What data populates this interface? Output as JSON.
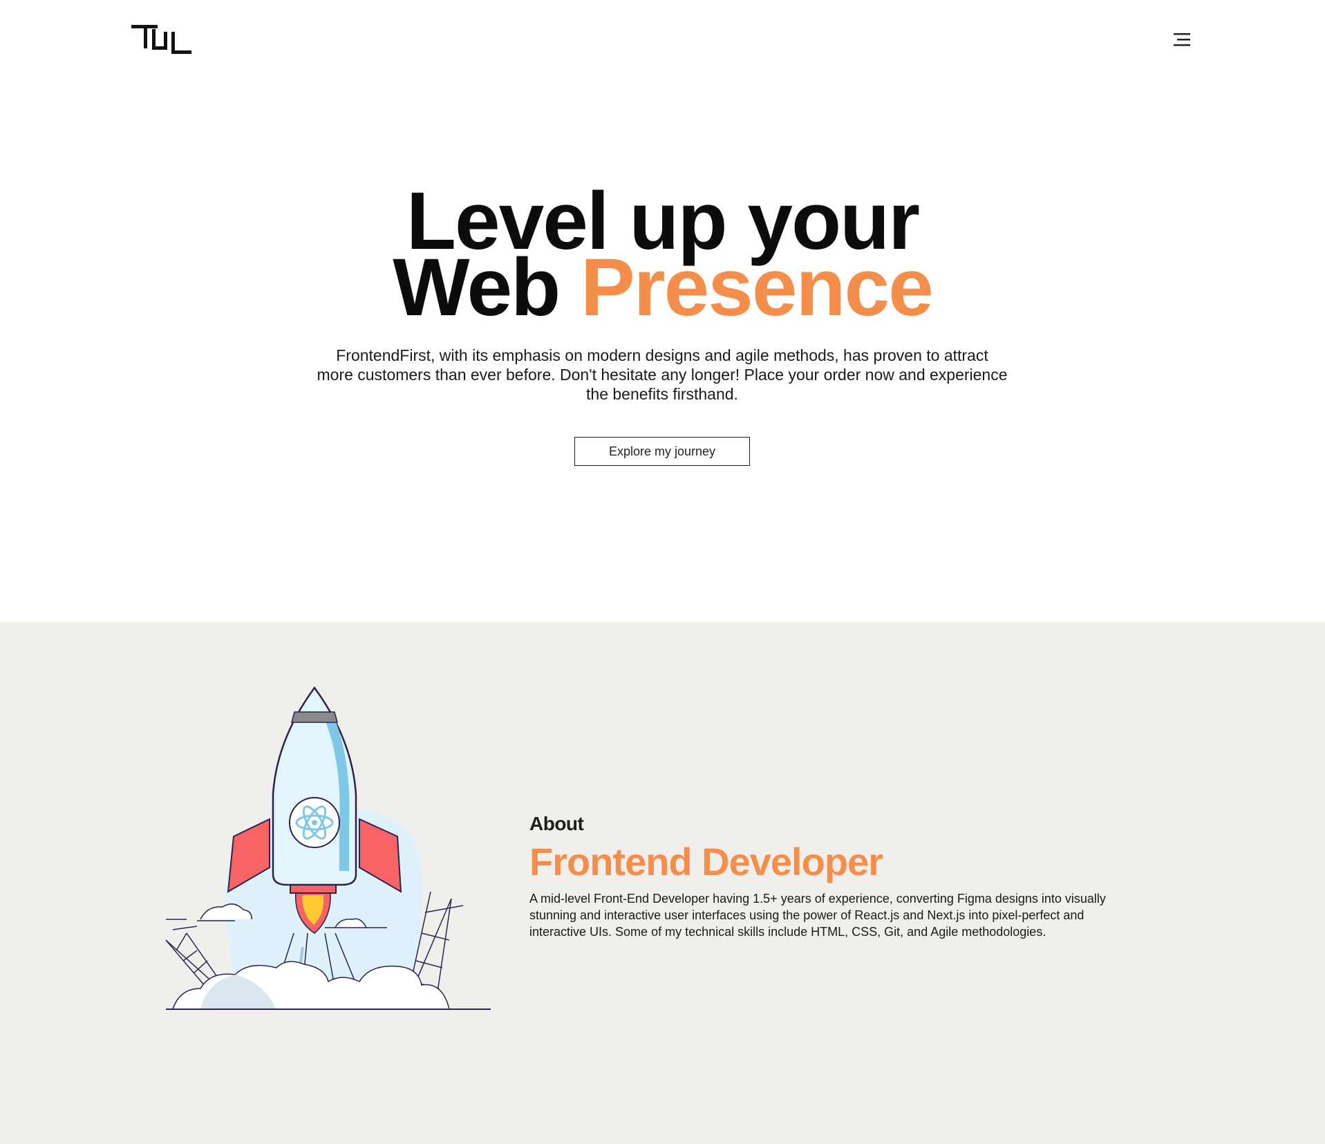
{
  "header": {
    "logo_alt": "TL logo",
    "menu_icon": "hamburger-menu-icon"
  },
  "hero": {
    "title_line1": "Level up your",
    "title_line2_plain": "Web",
    "title_line2_accent": "Presence",
    "description": "FrontendFirst, with its emphasis on modern designs and agile methods, has proven to attract more customers than ever before. Don't hesitate any longer! Place your order now and experience the benefits firsthand.",
    "cta_label": "Explore my journey"
  },
  "about": {
    "label": "About",
    "role": "Frontend Developer",
    "description": "A mid-level Front-End Developer having 1.5+ years of experience, converting Figma designs into visually stunning and interactive user interfaces using the power of React.js and Next.js into pixel-perfect and interactive UIs. Some of my technical skills include HTML, CSS, Git, and Agile methodologies.",
    "illustration": "rocket-launch-illustration"
  },
  "colors": {
    "accent": "#f68e4b",
    "about_bg": "#f0efeb",
    "text": "#111111"
  }
}
